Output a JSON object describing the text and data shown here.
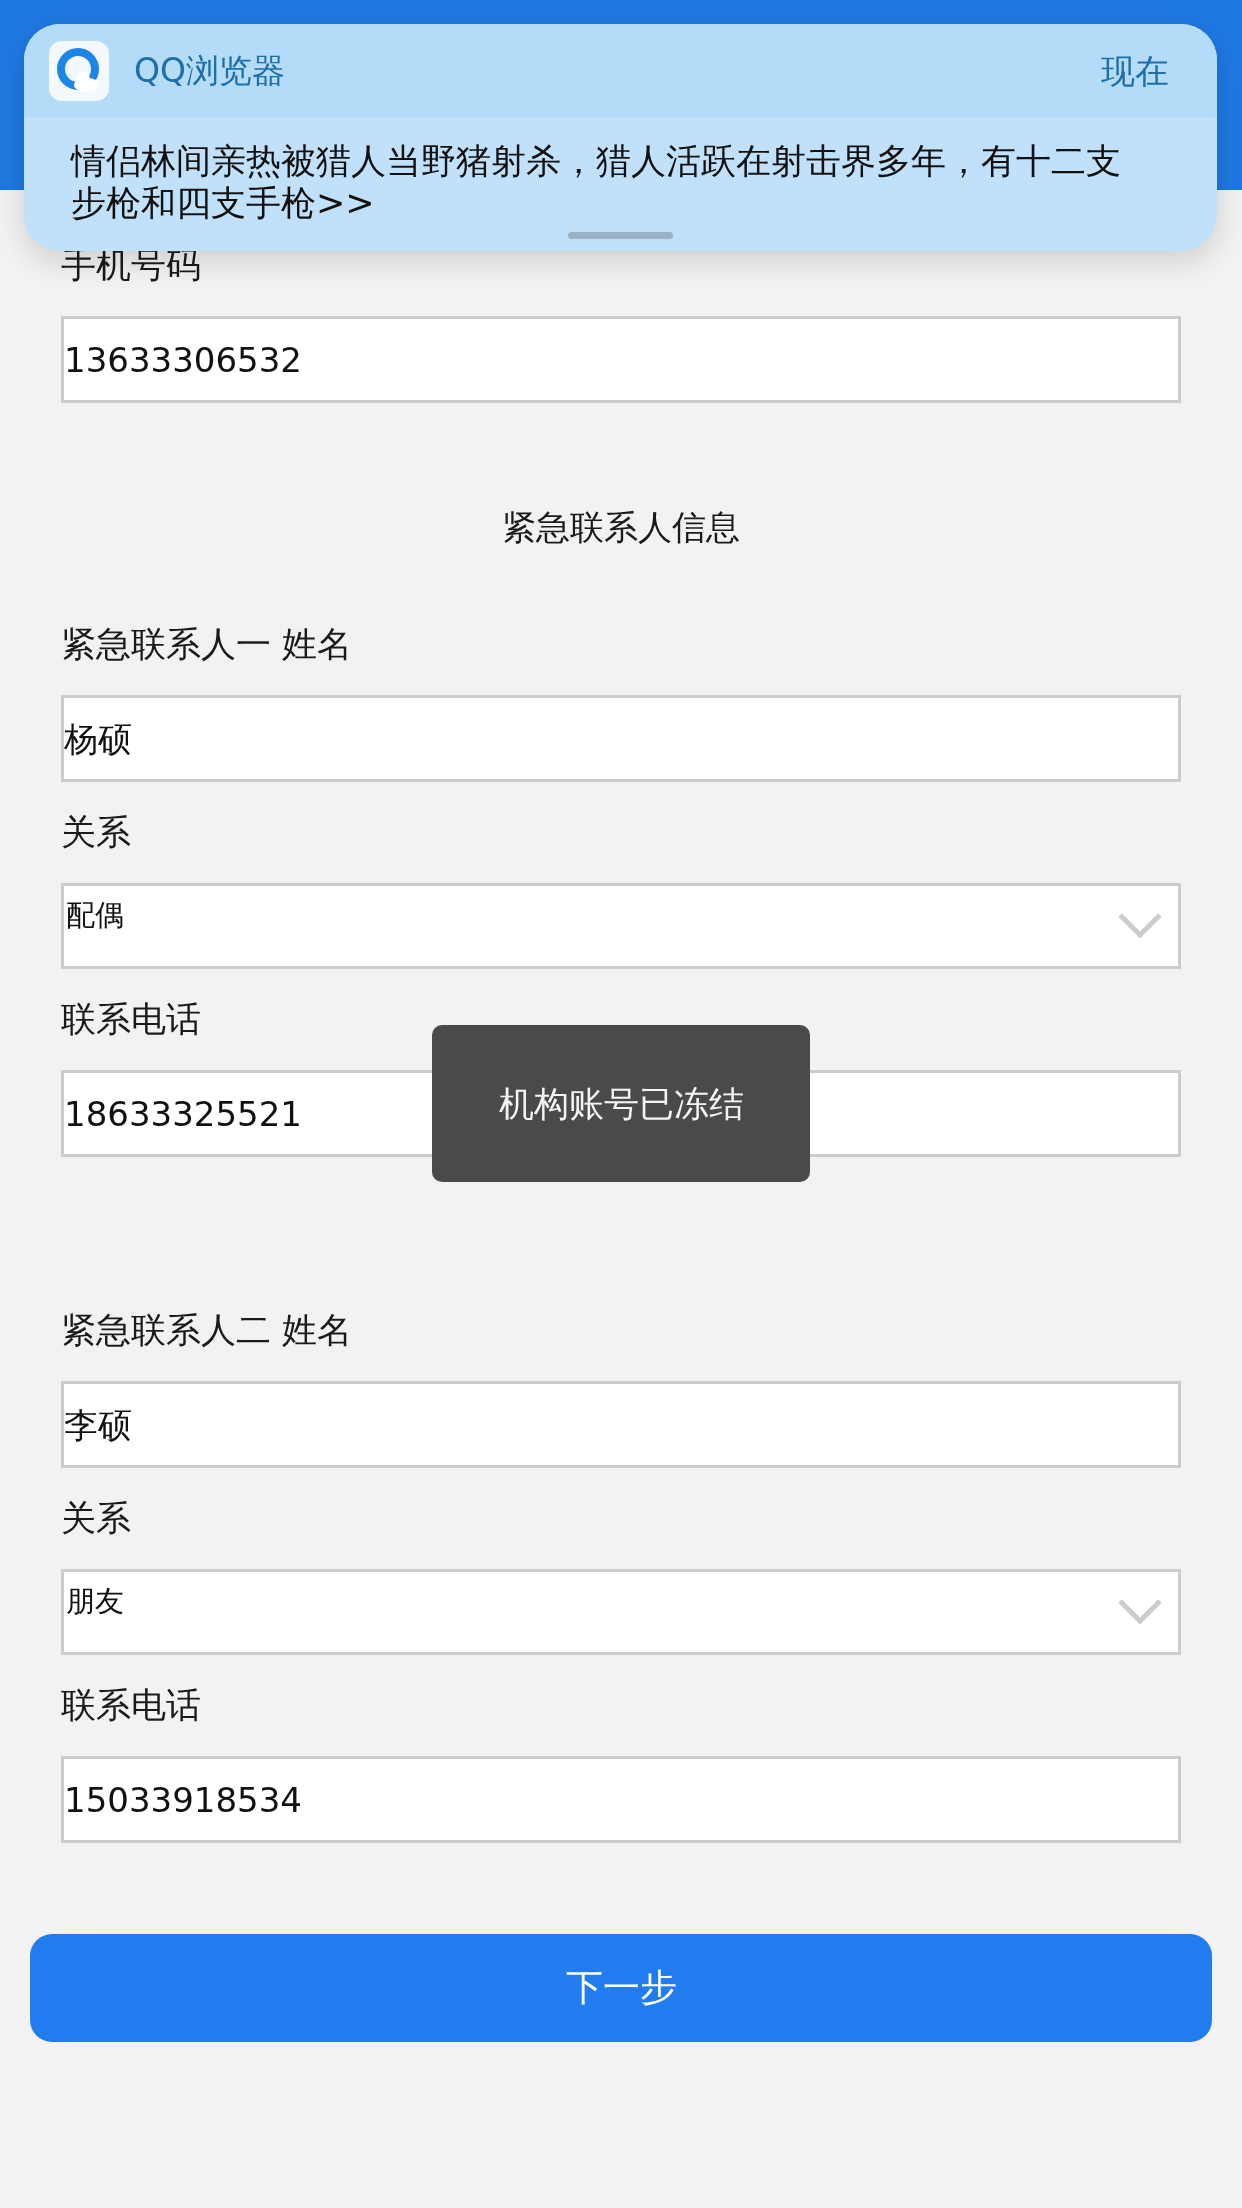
{
  "notification": {
    "app_name": "QQ浏览器",
    "time": "现在",
    "message": "情侣林间亲热被猎人当野猪射杀，猎人活跃在射击界多年，有十二支步枪和四支手枪>>"
  },
  "form": {
    "fields": [
      {
        "kind": "text",
        "label": "手机号码",
        "value": "13633306532"
      }
    ],
    "section_title": "紧急联系人信息",
    "contacts": [
      {
        "fields": [
          {
            "kind": "text",
            "label": "紧急联系人一 姓名",
            "value": "杨硕"
          },
          {
            "kind": "select",
            "label": "关系",
            "value": "配偶"
          },
          {
            "kind": "text",
            "label": "联系电话",
            "value": "18633325521"
          }
        ]
      },
      {
        "fields": [
          {
            "kind": "text",
            "label": "紧急联系人二 姓名",
            "value": "李硕"
          },
          {
            "kind": "select",
            "label": "关系",
            "value": "朋友"
          },
          {
            "kind": "text",
            "label": "联系电话",
            "value": "15033918534"
          }
        ]
      }
    ]
  },
  "toast": {
    "message": "机构账号已冻结"
  },
  "next_button": {
    "label": "下一步"
  }
}
